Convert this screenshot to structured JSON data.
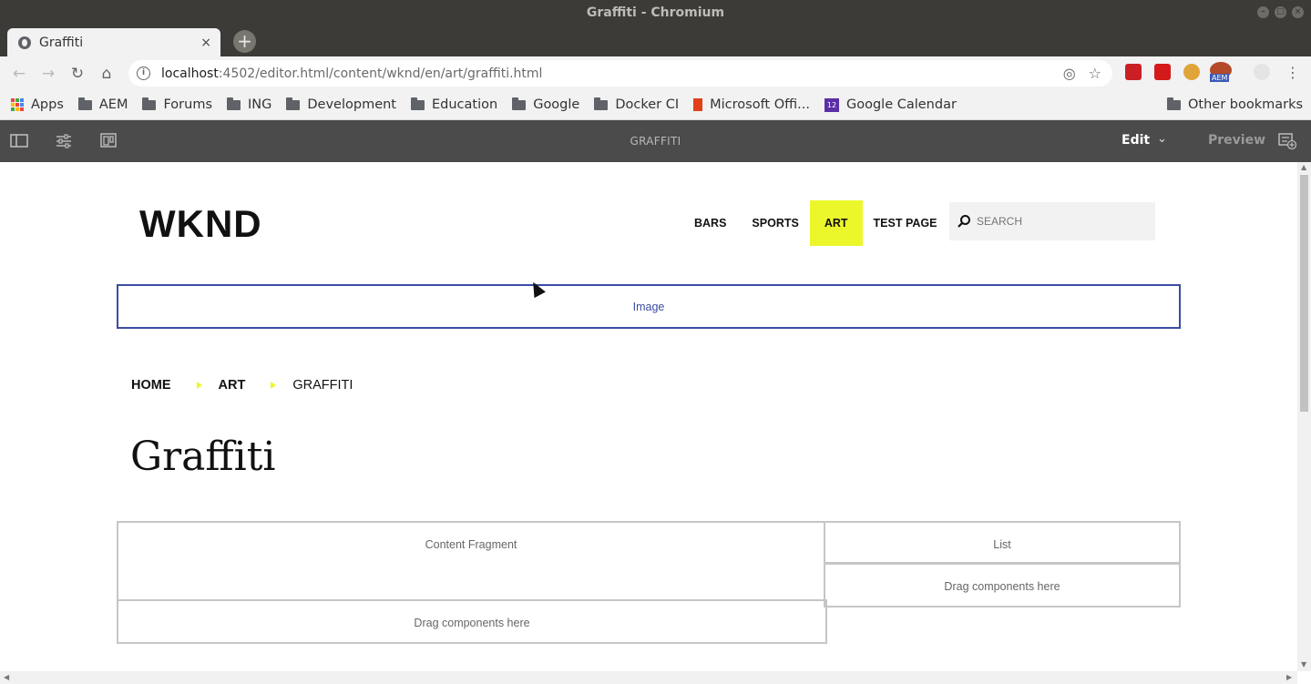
{
  "window": {
    "title": "Graffiti - Chromium"
  },
  "browser": {
    "tab": {
      "title": "Graffiti",
      "close": "×"
    },
    "new_tab": "+",
    "url_host": "localhost",
    "url_path": ":4502/editor.html/content/wknd/en/art/graffiti.html",
    "bookmarks": [
      {
        "label": "AEM"
      },
      {
        "label": "Forums"
      },
      {
        "label": "ING"
      },
      {
        "label": "Development"
      },
      {
        "label": "Education"
      },
      {
        "label": "Google"
      },
      {
        "label": "Docker CI"
      }
    ],
    "bookmark_apps": "Apps",
    "bookmark_office": "Microsoft Offi...",
    "bookmark_calendar": "Google Calendar",
    "calendar_day": "12",
    "bookmark_other": "Other bookmarks",
    "ext_aem_label": "AEM"
  },
  "aem_bar": {
    "page_name": "GRAFFITI",
    "mode": "Edit",
    "preview": "Preview"
  },
  "site": {
    "logo": "WKND",
    "nav": [
      "BARS",
      "SPORTS",
      "ART",
      "TEST PAGE"
    ],
    "active_nav": "ART",
    "accent_color": "#ecf72b",
    "search_placeholder": "SEARCH",
    "image_placeholder": "Image",
    "breadcrumb": [
      "HOME",
      "ART",
      "GRAFFITI"
    ],
    "title": "Graffiti",
    "content_fragment": "Content Fragment",
    "list": "List",
    "drag_right": "Drag components here",
    "drag_left": "Drag components here"
  }
}
